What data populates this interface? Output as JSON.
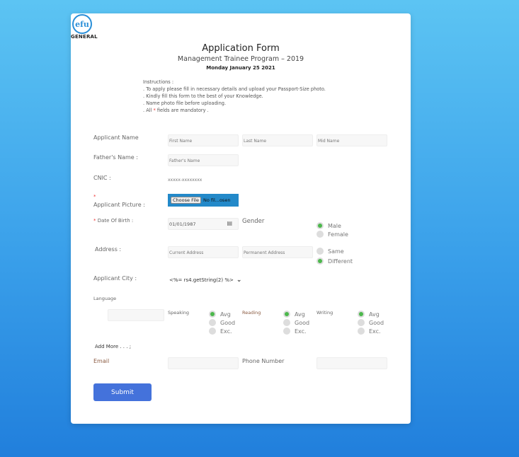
{
  "logo": {
    "text": "efu",
    "sub": "GENERAL"
  },
  "header": {
    "title": "Application Form",
    "subtitle": "Management Trainee Program – 2019",
    "date": "Monday January 25 2021"
  },
  "instructions": {
    "heading": "Instructions :",
    "lines": [
      ". To apply please fill in necessary details and upload your Passport-Size photo.",
      ". Kindly fill this form to the best of your Knowledge.",
      ". Name photo file before uploading."
    ],
    "mandatory_pre": ". All ",
    "mandatory_star": "*",
    "mandatory_post": " fields are mandatory ."
  },
  "form": {
    "applicant_name_label": "Applicant Name",
    "first_name_ph": "First Name",
    "last_name_ph": "Last Name",
    "mid_name_ph": "Mid Name",
    "father_label": "Father's Name :",
    "father_ph": "Father's Name",
    "cnic_label": "CNIC :",
    "cnic_ph": "xxxxx-xxxxxxxx",
    "required_star": "*",
    "picture_label": "Applicant Picture :",
    "choose_file": "Choose File",
    "no_file": "No fil...osen",
    "dob_label": "Date Of Birth :",
    "dob_value": "01/01/1987",
    "gender_label": "Gender",
    "gender_options": [
      "Male",
      "Female"
    ],
    "gender_selected": "Male",
    "address_label": "Address :",
    "current_address_ph": "Current Address",
    "permanent_address_ph": "Permanent Address",
    "address_options": [
      "Same",
      "Different"
    ],
    "address_selected": "Different",
    "city_label": "Applicant City :",
    "city_value": "<%= rs4.getString(2) %>",
    "language_label": "Language",
    "speaking_label": "Speaking",
    "reading_label": "Reading",
    "writing_label": "Writing",
    "level_options": [
      "Avg",
      "Good",
      "Exc."
    ],
    "level_selected": "Avg",
    "add_more": "Add More . . . ;",
    "email_label": "Email",
    "phone_label": "Phone Number",
    "submit": "Submit"
  },
  "colors": {
    "accent": "#4472db",
    "radio_on": "#4cb84c",
    "file_bg": "#2389c9"
  }
}
